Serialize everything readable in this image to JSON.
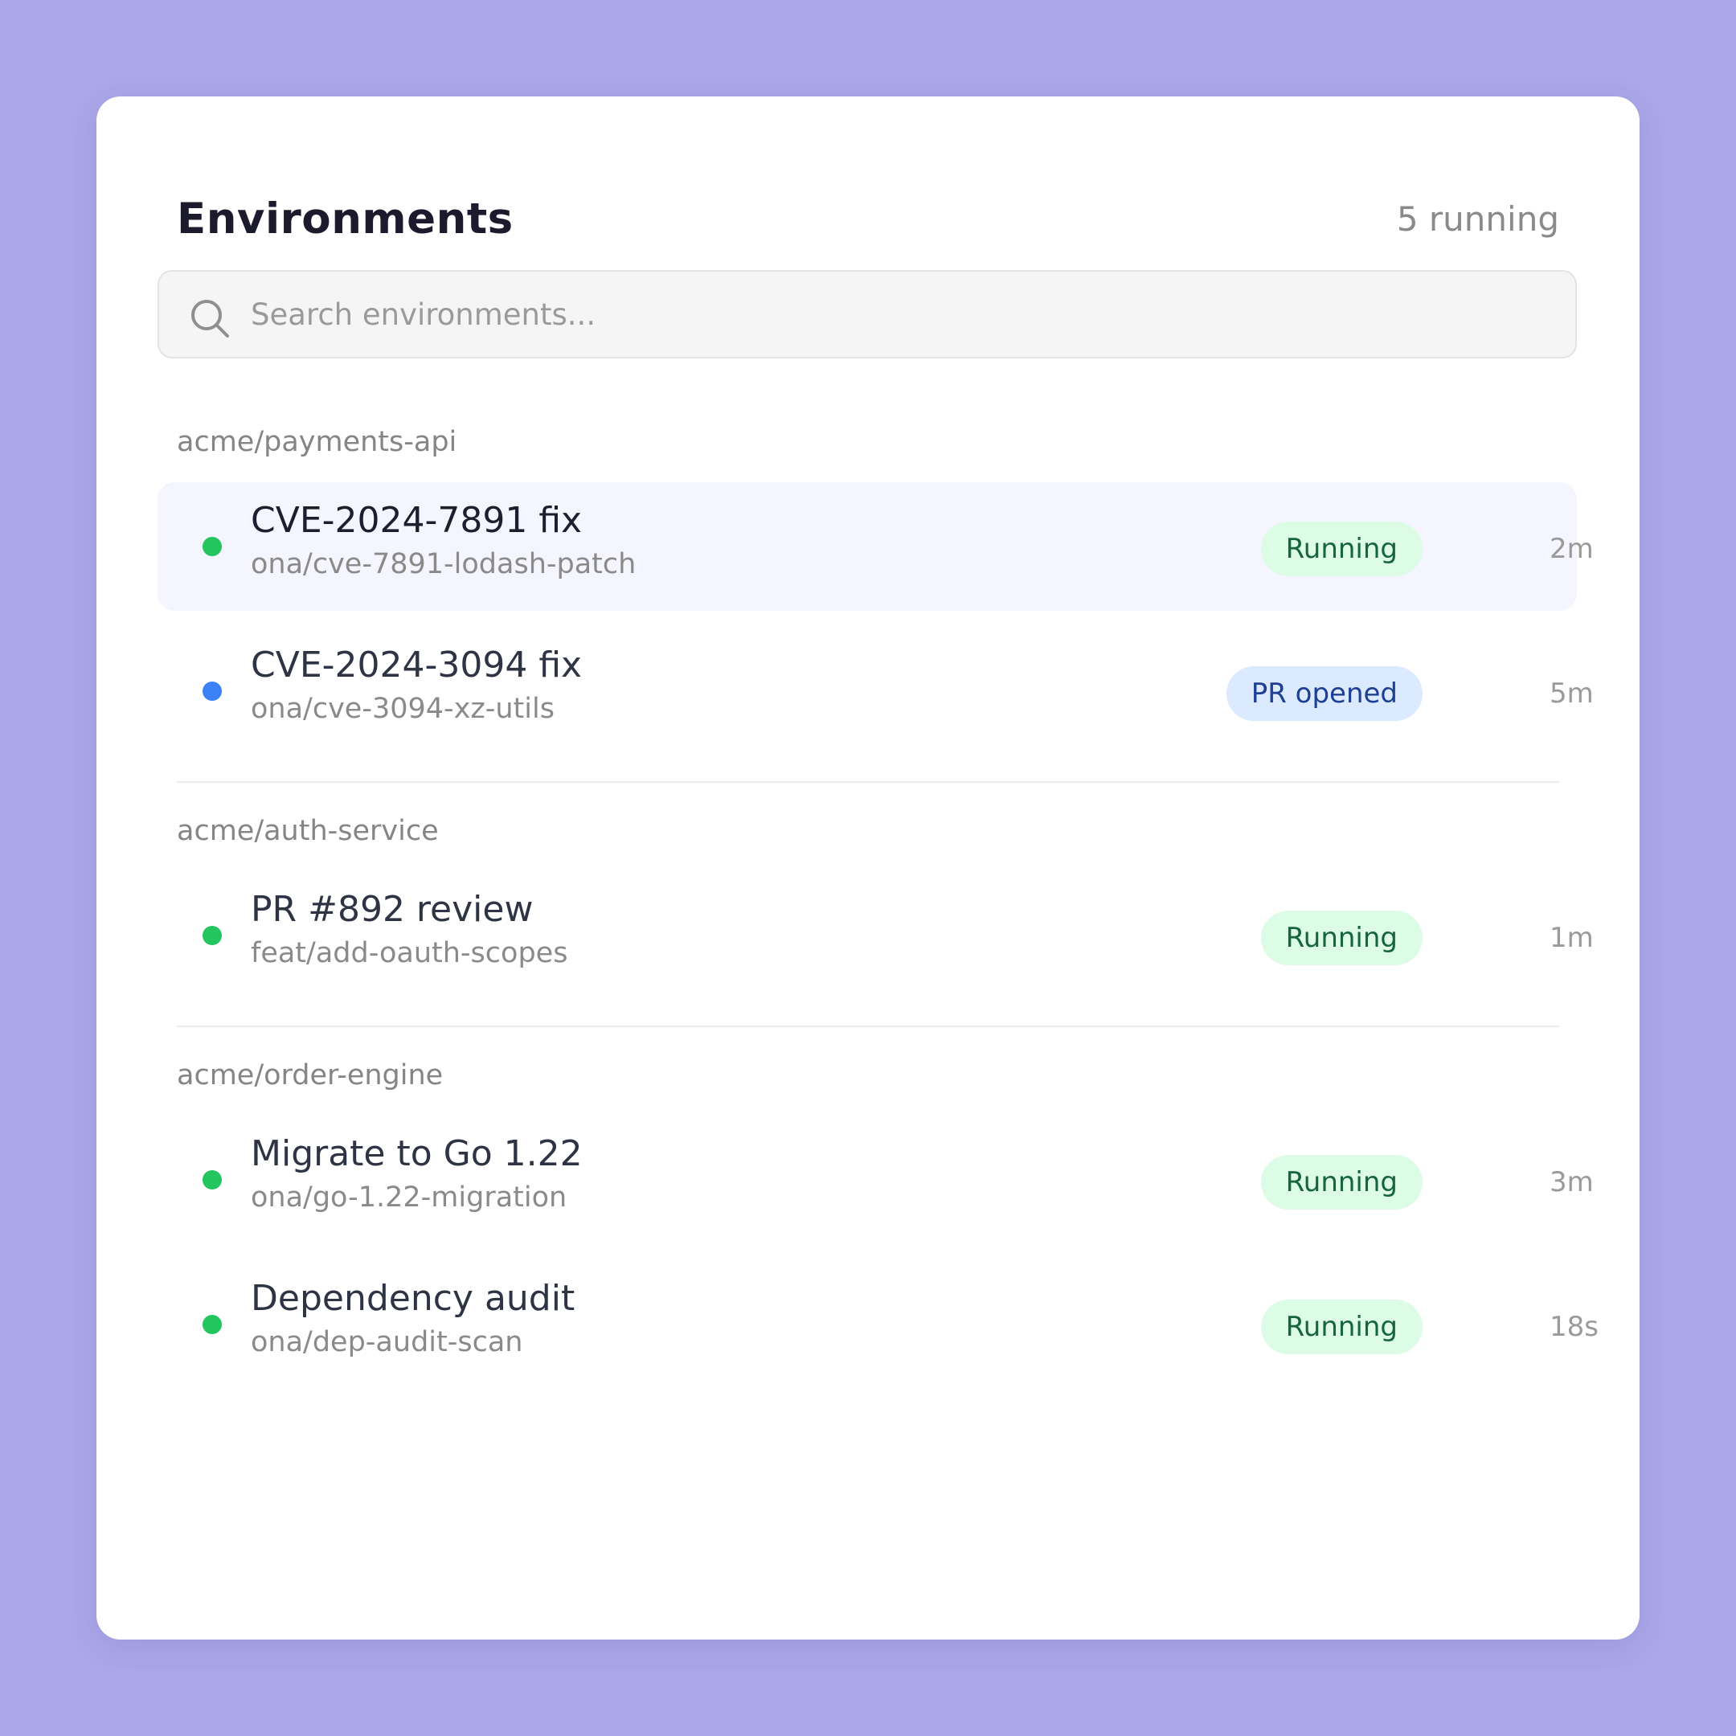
{
  "header": {
    "title": "Environments",
    "count": "5 running"
  },
  "search": {
    "placeholder": "Search environments...",
    "value": ""
  },
  "groups": [
    {
      "label": "acme/payments-api",
      "items": [
        {
          "title": "CVE-2024-7891 fix",
          "branch": "ona/cve-7891-lodash-patch",
          "status": "Running",
          "time": "2m",
          "dot_color": "#22c55e",
          "selected": true
        },
        {
          "title": "CVE-2024-3094 fix",
          "branch": "ona/cve-3094-xz-utils",
          "status": "PR opened",
          "time": "5m",
          "dot_color": "#3b82f6"
        }
      ]
    },
    {
      "label": "acme/auth-service",
      "items": [
        {
          "title": "PR #892 review",
          "branch": "feat/add-oauth-scopes",
          "status": "Running",
          "time": "1m",
          "dot_color": "#22c55e"
        }
      ]
    },
    {
      "label": "acme/order-engine",
      "items": [
        {
          "title": "Migrate to Go 1.22",
          "branch": "ona/go-1.22-migration",
          "status": "Running",
          "time": "3m",
          "dot_color": "#22c55e"
        },
        {
          "title": "Dependency audit",
          "branch": "ona/dep-audit-scan",
          "status": "Running",
          "time": "18s",
          "dot_color": "#22c55e"
        }
      ]
    }
  ],
  "colors": {
    "background": "#aba7e8",
    "running_badge_bg": "#dcfce5",
    "running_badge_text": "#17653a",
    "pr_badge_bg": "#dbeafe",
    "pr_badge_text": "#1e3f94",
    "selected_row_bg": "#f4f5fe"
  },
  "icons": {
    "search": "search-icon"
  }
}
